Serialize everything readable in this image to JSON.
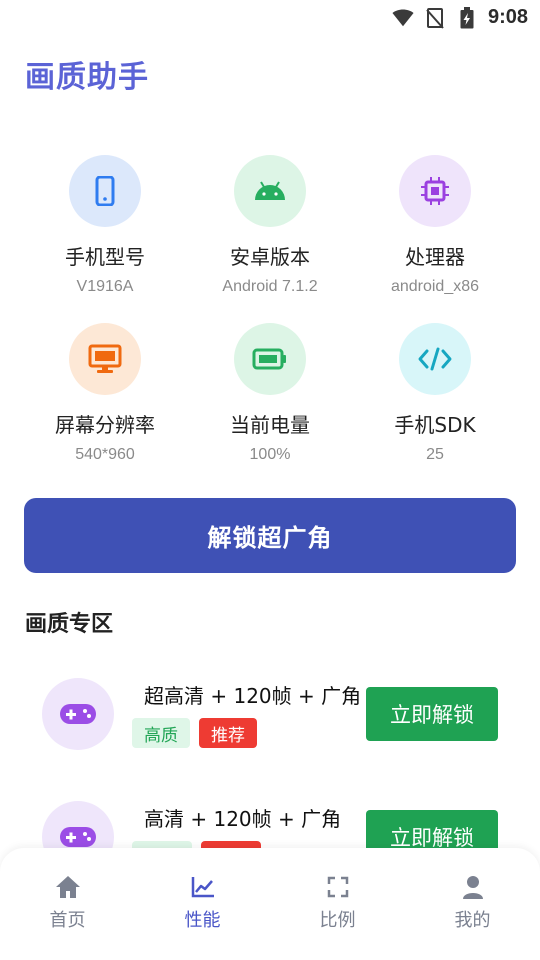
{
  "status": {
    "time": "9:08",
    "wifi_icon": "wifi-icon",
    "signal_icon": "no-signal-icon",
    "battery_icon": "battery-charging-icon"
  },
  "app": {
    "title": "画质助手"
  },
  "device_info": [
    {
      "label": "手机型号",
      "value": "V1916A",
      "icon": "phone-icon",
      "bg": "#dce8fb",
      "color": "#2f7cf0"
    },
    {
      "label": "安卓版本",
      "value": "Android 7.1.2",
      "icon": "android-icon",
      "bg": "#ddf5e6",
      "color": "#27ae60"
    },
    {
      "label": "处理器",
      "value": "android_x86",
      "icon": "cpu-icon",
      "bg": "#efe4fb",
      "color": "#9b40e0"
    },
    {
      "label": "屏幕分辨率",
      "value": "540*960",
      "icon": "monitor-icon",
      "bg": "#fde8d6",
      "color": "#f06a10"
    },
    {
      "label": "当前电量",
      "value": "100%",
      "icon": "battery-icon",
      "bg": "#ddf5e6",
      "color": "#27ae60"
    },
    {
      "label": "手机SDK",
      "value": "25",
      "icon": "code-icon",
      "bg": "#d8f6f9",
      "color": "#16a7c1"
    }
  ],
  "unlock_button": {
    "label": "解锁超广角"
  },
  "quality_section": {
    "title": "画质专区",
    "items": [
      {
        "title": "超高清 + 120帧 + 广角",
        "tag_quality": "高质",
        "tag_recommend": "推荐",
        "button": "立即解锁",
        "icon": "gamepad-icon"
      },
      {
        "title": "高清 + 120帧 + 广角",
        "tag_quality": "",
        "tag_recommend": "",
        "button": "立即解锁",
        "icon": "gamepad-icon"
      }
    ]
  },
  "nav": {
    "items": [
      {
        "label": "首页",
        "icon": "home-icon",
        "active": false
      },
      {
        "label": "性能",
        "icon": "chart-icon",
        "active": true
      },
      {
        "label": "比例",
        "icon": "fullscreen-icon",
        "active": false
      },
      {
        "label": "我的",
        "icon": "user-icon",
        "active": false
      }
    ]
  }
}
